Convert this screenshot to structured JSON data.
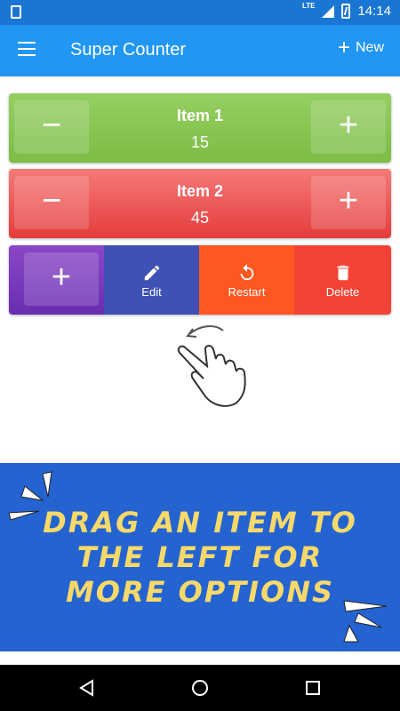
{
  "status_bar": {
    "network": "LTE",
    "time": "14:14"
  },
  "app_bar": {
    "title": "Super Counter",
    "new_label": "New"
  },
  "counters": [
    {
      "name": "Item 1",
      "value": "15",
      "color": "#8bc34a"
    },
    {
      "name": "Item 2",
      "value": "45",
      "color": "#ef5350"
    }
  ],
  "row_actions": [
    {
      "label": "Edit",
      "icon": "pencil-icon",
      "color": "#3f51b5"
    },
    {
      "label": "Restart",
      "icon": "restart-icon",
      "color": "#ff5722"
    },
    {
      "label": "Delete",
      "icon": "trash-icon",
      "color": "#f44336"
    }
  ],
  "tip": {
    "lines": [
      "DRAG AN ITEM TO",
      "THE LEFT FOR",
      "MORE OPTIONS"
    ],
    "background": "#2463d0",
    "text_color": "#f6d96a"
  },
  "icons": {
    "minus": "−",
    "plus": "+"
  }
}
